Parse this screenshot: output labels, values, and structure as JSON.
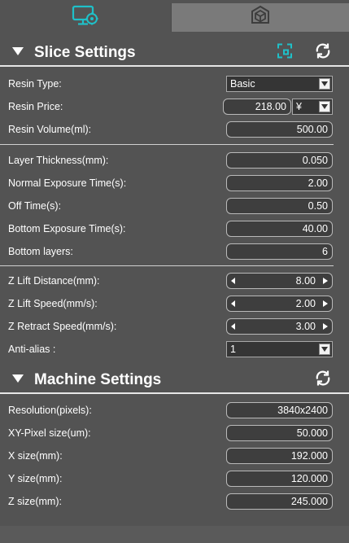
{
  "colors": {
    "accent": "#1fc0c8",
    "background": "#535353",
    "tab_inactive": "#7a7a7a",
    "field_bg": "#3e3e3e"
  },
  "tabs": [
    {
      "name": "slice-settings-tab",
      "icon": "monitor-gear-icon",
      "active": true
    },
    {
      "name": "model-tab",
      "icon": "cube-house-icon",
      "active": false
    }
  ],
  "slice": {
    "title": "Slice Settings",
    "resin_type": {
      "label": "Resin Type:",
      "value": "Basic"
    },
    "resin_price": {
      "label": "Resin Price:",
      "value": "218.00",
      "currency": "¥"
    },
    "resin_volume": {
      "label": "Resin Volume(ml):",
      "value": "500.00"
    },
    "layer_thickness": {
      "label": "Layer Thickness(mm):",
      "value": "0.050"
    },
    "normal_exposure": {
      "label": "Normal Exposure Time(s):",
      "value": "2.00"
    },
    "off_time": {
      "label": "Off Time(s):",
      "value": "0.50"
    },
    "bottom_exposure": {
      "label": "Bottom Exposure Time(s):",
      "value": "40.00"
    },
    "bottom_layers": {
      "label": "Bottom layers:",
      "value": "6"
    },
    "z_lift_distance": {
      "label": "Z Lift Distance(mm):",
      "value": "8.00"
    },
    "z_lift_speed": {
      "label": "Z Lift Speed(mm/s):",
      "value": "2.00"
    },
    "z_retract_speed": {
      "label": "Z Retract Speed(mm/s):",
      "value": "3.00"
    },
    "anti_alias": {
      "label": "Anti-alias :",
      "value": "1"
    }
  },
  "machine": {
    "title": "Machine Settings",
    "resolution": {
      "label": "Resolution(pixels):",
      "value": "3840x2400"
    },
    "xy_pixel": {
      "label": "XY-Pixel size(um):",
      "value": "50.000"
    },
    "x_size": {
      "label": "X size(mm):",
      "value": "192.000"
    },
    "y_size": {
      "label": "Y size(mm):",
      "value": "120.000"
    },
    "z_size": {
      "label": "Z size(mm):",
      "value": "245.000"
    }
  }
}
